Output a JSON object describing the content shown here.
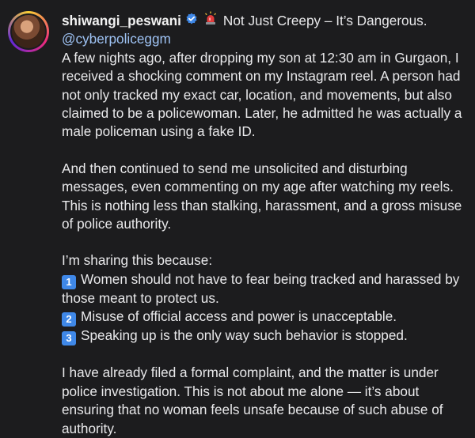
{
  "post": {
    "username": "shiwangi_peswani",
    "title": "Not Just Creepy – It’s Dangerous.",
    "mention": "@cyberpoliceggm",
    "paragraphs": [
      "A few nights ago, after dropping my son at 12:30 am in Gurgaon, I received a shocking comment on my Instagram reel. A person had not only tracked my exact car, location, and movements, but also claimed to be a policewoman. Later, he admitted he was actually a male policeman using a fake ID.",
      "And then continued to send me unsolicited and disturbing messages, even commenting on my age after watching my reels. This is nothing less than stalking, harassment, and a gross misuse of police authority.",
      "I’m sharing this because:"
    ],
    "list": [
      {
        "num": "1",
        "text": "Women should not have to fear being tracked and harassed by those meant to protect us."
      },
      {
        "num": "2",
        "text": "Misuse of official access and power is unacceptable."
      },
      {
        "num": "3",
        "text": "Speaking up is the only way such behavior is stopped."
      }
    ],
    "closing": "I have already filed a formal complaint, and the matter is under police investigation. This is not about me alone — it’s about ensuring that no woman feels unsafe because of such abuse of authority."
  },
  "icons": {
    "verified": "verified-badge-icon",
    "siren": "police-siren-icon"
  },
  "colors": {
    "background": "#1c1c1e",
    "text": "#e9e9eb",
    "mention": "#9ec2f3",
    "verified": "#3f88e8",
    "keycap": "#3f88e8"
  }
}
